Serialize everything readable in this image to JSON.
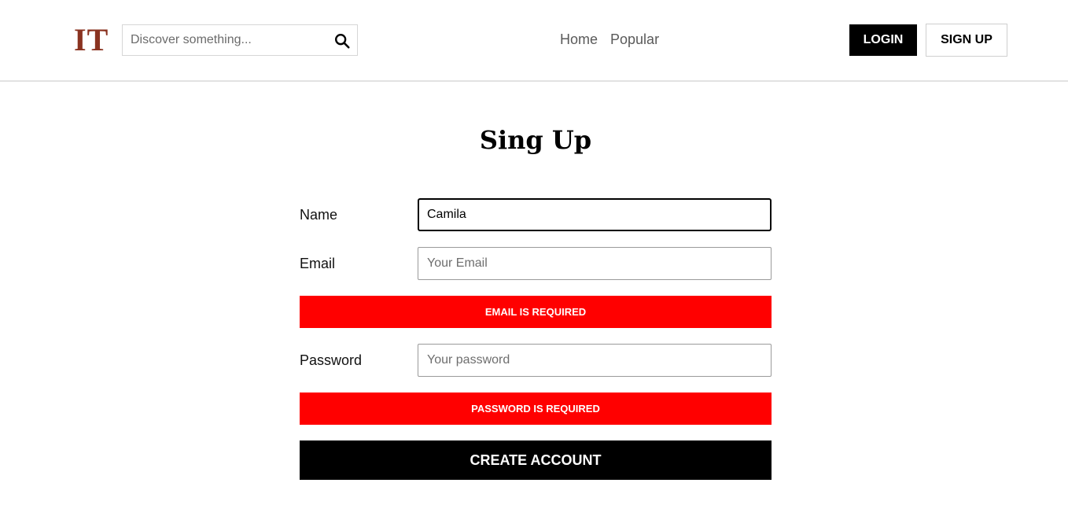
{
  "header": {
    "logo": "IT",
    "search": {
      "placeholder": "Discover something...",
      "value": ""
    },
    "nav": [
      {
        "label": "Home"
      },
      {
        "label": "Popular"
      }
    ],
    "login_label": "LOGIN",
    "signup_label": "SIGN UP"
  },
  "page": {
    "title": "Sing Up"
  },
  "form": {
    "name": {
      "label": "Name",
      "value": "Camila",
      "placeholder": ""
    },
    "email": {
      "label": "Email",
      "value": "",
      "placeholder": "Your Email",
      "error": "EMAIL IS REQUIRED"
    },
    "password": {
      "label": "Password",
      "value": "",
      "placeholder": "Your password",
      "error": "PASSWORD IS REQUIRED"
    },
    "submit_label": "CREATE ACCOUNT"
  },
  "colors": {
    "logo": "#8a3320",
    "error": "#ff0000",
    "primary_button": "#000000"
  },
  "icons": {
    "search": "search-icon"
  }
}
